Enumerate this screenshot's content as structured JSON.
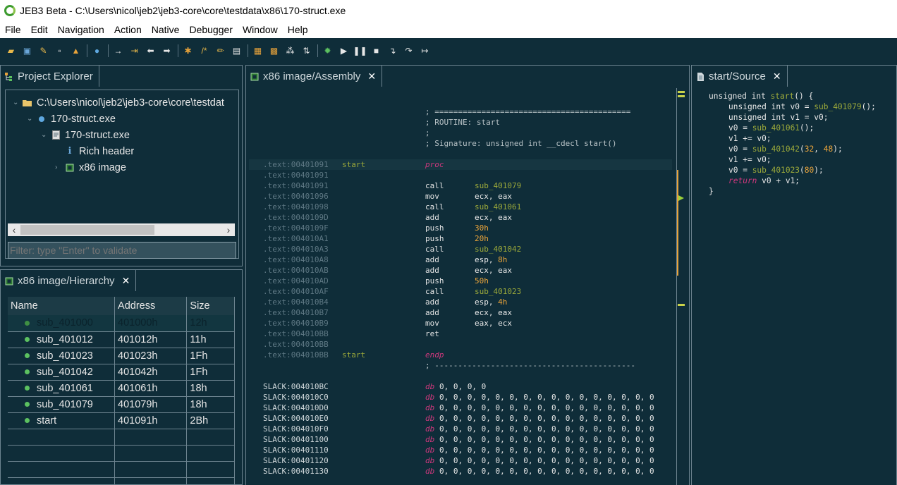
{
  "window": {
    "title": "JEB3 Beta - C:\\Users\\nicol\\jeb2\\jeb3-core\\core\\testdata\\x86\\170-struct.exe"
  },
  "menu": [
    "File",
    "Edit",
    "Navigation",
    "Action",
    "Native",
    "Debugger",
    "Window",
    "Help"
  ],
  "toolbar_icons": [
    "open-folder-icon",
    "save-icon",
    "wrench-icon",
    "close-project-icon",
    "notification-icon",
    "globe-icon",
    "jump-to-icon",
    "go-to-address-icon",
    "back-arrow-icon",
    "forward-arrow-icon",
    "parse-icon",
    "comment-icon",
    "rename-icon",
    "export-icon",
    "decompile-icon",
    "graph-icon",
    "references-icon",
    "cross-ref-icon",
    "attach-debugger-icon",
    "run-icon",
    "pause-icon",
    "stop-icon",
    "step-into-icon",
    "step-over-icon",
    "step-out-icon"
  ],
  "project_explorer": {
    "tab_label": "Project Explorer",
    "tree": [
      {
        "label": "C:\\Users\\nicol\\jeb2\\jeb3-core\\core\\testdat",
        "icon": "folder-icon",
        "depth": 0,
        "twisty": "v"
      },
      {
        "label": "170-struct.exe",
        "icon": "artifact-icon",
        "depth": 1,
        "twisty": "v"
      },
      {
        "label": "170-struct.exe",
        "icon": "file-icon",
        "depth": 2,
        "twisty": "v"
      },
      {
        "label": "Rich header",
        "icon": "info-icon",
        "depth": 3,
        "twisty": ""
      },
      {
        "label": "x86 image",
        "icon": "chip-icon",
        "depth": 3,
        "twisty": ">"
      }
    ],
    "filter_placeholder": "Filter: type \"Enter\" to validate"
  },
  "hierarchy": {
    "tab_label": "x86 image/Hierarchy",
    "columns": [
      "Name",
      "Address",
      "Size"
    ],
    "rows": [
      {
        "name": "sub_401000",
        "address": "401000h",
        "size": "12h",
        "selected": true
      },
      {
        "name": "sub_401012",
        "address": "401012h",
        "size": "11h"
      },
      {
        "name": "sub_401023",
        "address": "401023h",
        "size": "1Fh"
      },
      {
        "name": "sub_401042",
        "address": "401042h",
        "size": "1Fh"
      },
      {
        "name": "sub_401061",
        "address": "401061h",
        "size": "18h"
      },
      {
        "name": "sub_401079",
        "address": "401079h",
        "size": "18h"
      },
      {
        "name": "start",
        "address": "401091h",
        "size": "2Bh"
      }
    ],
    "empty_rows": 4
  },
  "assembly": {
    "tab_label": "x86 image/Assembly",
    "header_lines": [
      "; ==========================================",
      "; ROUTINE: start",
      ";",
      "; Signature: unsigned int __cdecl start()"
    ],
    "lines": [
      {
        "addr": ".text:00401091",
        "label": "start",
        "mn": "proc",
        "ops": []
      },
      {
        "addr": ".text:00401091",
        "label": "",
        "mn": "",
        "ops": []
      },
      {
        "addr": ".text:00401091",
        "label": "",
        "mn": "call",
        "ops": [
          {
            "t": "ref",
            "v": "sub_401079"
          }
        ]
      },
      {
        "addr": ".text:00401096",
        "label": "",
        "mn": "mov",
        "ops": [
          {
            "t": "reg",
            "v": "ecx, eax"
          }
        ]
      },
      {
        "addr": ".text:00401098",
        "label": "",
        "mn": "call",
        "ops": [
          {
            "t": "ref",
            "v": "sub_401061"
          }
        ]
      },
      {
        "addr": ".text:0040109D",
        "label": "",
        "mn": "add",
        "ops": [
          {
            "t": "reg",
            "v": "ecx, eax"
          }
        ]
      },
      {
        "addr": ".text:0040109F",
        "label": "",
        "mn": "push",
        "ops": [
          {
            "t": "num",
            "v": "30h"
          }
        ]
      },
      {
        "addr": ".text:004010A1",
        "label": "",
        "mn": "push",
        "ops": [
          {
            "t": "num",
            "v": "20h"
          }
        ]
      },
      {
        "addr": ".text:004010A3",
        "label": "",
        "mn": "call",
        "ops": [
          {
            "t": "ref",
            "v": "sub_401042"
          }
        ]
      },
      {
        "addr": ".text:004010A8",
        "label": "",
        "mn": "add",
        "ops": [
          {
            "t": "reg",
            "v": "esp, "
          },
          {
            "t": "num",
            "v": "8h"
          }
        ]
      },
      {
        "addr": ".text:004010AB",
        "label": "",
        "mn": "add",
        "ops": [
          {
            "t": "reg",
            "v": "ecx, eax"
          }
        ]
      },
      {
        "addr": ".text:004010AD",
        "label": "",
        "mn": "push",
        "ops": [
          {
            "t": "num",
            "v": "50h"
          }
        ]
      },
      {
        "addr": ".text:004010AF",
        "label": "",
        "mn": "call",
        "ops": [
          {
            "t": "ref",
            "v": "sub_401023"
          }
        ]
      },
      {
        "addr": ".text:004010B4",
        "label": "",
        "mn": "add",
        "ops": [
          {
            "t": "reg",
            "v": "esp, "
          },
          {
            "t": "num",
            "v": "4h"
          }
        ]
      },
      {
        "addr": ".text:004010B7",
        "label": "",
        "mn": "add",
        "ops": [
          {
            "t": "reg",
            "v": "ecx, eax"
          }
        ]
      },
      {
        "addr": ".text:004010B9",
        "label": "",
        "mn": "mov",
        "ops": [
          {
            "t": "reg",
            "v": "eax, ecx"
          }
        ]
      },
      {
        "addr": ".text:004010BB",
        "label": "",
        "mn": "ret",
        "ops": []
      },
      {
        "addr": ".text:004010BB",
        "label": "",
        "mn": "",
        "ops": []
      },
      {
        "addr": ".text:004010BB",
        "label": "start",
        "mn": "endp",
        "ops": []
      }
    ],
    "separator": "; -------------------------------------------",
    "slack": [
      {
        "addr": "SLACK:004010BC",
        "data": "0, 0, 0, 0"
      },
      {
        "addr": "SLACK:004010C0",
        "data": "0, 0, 0, 0, 0, 0, 0, 0, 0, 0, 0, 0, 0, 0, 0, 0"
      },
      {
        "addr": "SLACK:004010D0",
        "data": "0, 0, 0, 0, 0, 0, 0, 0, 0, 0, 0, 0, 0, 0, 0, 0"
      },
      {
        "addr": "SLACK:004010E0",
        "data": "0, 0, 0, 0, 0, 0, 0, 0, 0, 0, 0, 0, 0, 0, 0, 0"
      },
      {
        "addr": "SLACK:004010F0",
        "data": "0, 0, 0, 0, 0, 0, 0, 0, 0, 0, 0, 0, 0, 0, 0, 0"
      },
      {
        "addr": "SLACK:00401100",
        "data": "0, 0, 0, 0, 0, 0, 0, 0, 0, 0, 0, 0, 0, 0, 0, 0"
      },
      {
        "addr": "SLACK:00401110",
        "data": "0, 0, 0, 0, 0, 0, 0, 0, 0, 0, 0, 0, 0, 0, 0, 0"
      },
      {
        "addr": "SLACK:00401120",
        "data": "0, 0, 0, 0, 0, 0, 0, 0, 0, 0, 0, 0, 0, 0, 0, 0"
      },
      {
        "addr": "SLACK:00401130",
        "data": "0, 0, 0, 0, 0, 0, 0, 0, 0, 0, 0, 0, 0, 0, 0, 0"
      }
    ],
    "db_keyword": "db"
  },
  "source": {
    "tab_label": "start/Source",
    "lines": [
      {
        "indent": 0,
        "parts": [
          {
            "t": "txt",
            "v": "unsigned int "
          },
          {
            "t": "fn",
            "v": "start"
          },
          {
            "t": "txt",
            "v": "() {"
          }
        ]
      },
      {
        "indent": 1,
        "parts": [
          {
            "t": "txt",
            "v": "unsigned int v0 = "
          },
          {
            "t": "fn",
            "v": "sub_401079"
          },
          {
            "t": "txt",
            "v": "();"
          }
        ]
      },
      {
        "indent": 1,
        "parts": [
          {
            "t": "txt",
            "v": "unsigned int v1 = v0;"
          }
        ]
      },
      {
        "indent": 1,
        "parts": [
          {
            "t": "txt",
            "v": "v0 = "
          },
          {
            "t": "fn",
            "v": "sub_401061"
          },
          {
            "t": "txt",
            "v": "();"
          }
        ]
      },
      {
        "indent": 1,
        "parts": [
          {
            "t": "txt",
            "v": "v1 += v0;"
          }
        ]
      },
      {
        "indent": 1,
        "parts": [
          {
            "t": "txt",
            "v": "v0 = "
          },
          {
            "t": "fn",
            "v": "sub_401042"
          },
          {
            "t": "txt",
            "v": "("
          },
          {
            "t": "num",
            "v": "32"
          },
          {
            "t": "txt",
            "v": ", "
          },
          {
            "t": "num",
            "v": "48"
          },
          {
            "t": "txt",
            "v": ");"
          }
        ]
      },
      {
        "indent": 1,
        "parts": [
          {
            "t": "txt",
            "v": "v1 += v0;"
          }
        ]
      },
      {
        "indent": 1,
        "parts": [
          {
            "t": "txt",
            "v": "v0 = "
          },
          {
            "t": "fn",
            "v": "sub_401023"
          },
          {
            "t": "txt",
            "v": "("
          },
          {
            "t": "num",
            "v": "80"
          },
          {
            "t": "txt",
            "v": ");"
          }
        ]
      },
      {
        "indent": 1,
        "parts": [
          {
            "t": "kw",
            "v": "return"
          },
          {
            "t": "txt",
            "v": " v0 + v1;"
          }
        ]
      },
      {
        "indent": 0,
        "parts": [
          {
            "t": "txt",
            "v": "}"
          }
        ]
      }
    ]
  },
  "colors": {
    "background": "#0f2d39",
    "label": "#9aa83a",
    "keyword": "#d1387e",
    "number": "#e8a33a",
    "address": "#5e7884"
  }
}
